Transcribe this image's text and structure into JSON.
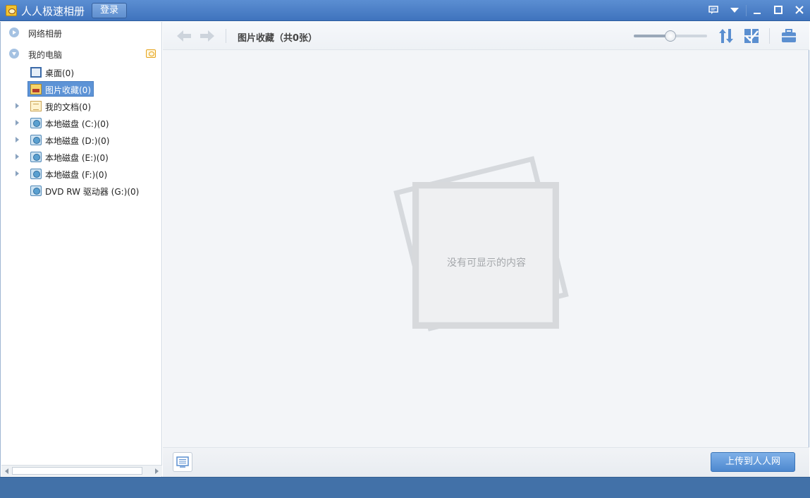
{
  "titlebar": {
    "app_title": "人人极速相册",
    "login_label": "登录",
    "icons": [
      "message-icon",
      "dropdown-icon",
      "minimize-icon",
      "maximize-icon",
      "close-icon"
    ]
  },
  "sidebar": {
    "groups": [
      {
        "label": "网络相册",
        "expanded": false
      },
      {
        "label": "我的电脑",
        "expanded": true
      }
    ],
    "items": [
      {
        "label": "桌面(0)",
        "icon": "desktop-icon",
        "has_arrow": false,
        "selected": false
      },
      {
        "label": "图片收藏(0)",
        "icon": "pictures-folder-icon",
        "has_arrow": false,
        "selected": true
      },
      {
        "label": "我的文档(0)",
        "icon": "documents-icon",
        "has_arrow": true,
        "selected": false
      },
      {
        "label": "本地磁盘 (C:)(0)",
        "icon": "disk-icon",
        "has_arrow": true,
        "selected": false
      },
      {
        "label": "本地磁盘 (D:)(0)",
        "icon": "disk-icon",
        "has_arrow": true,
        "selected": false
      },
      {
        "label": "本地磁盘 (E:)(0)",
        "icon": "disk-icon",
        "has_arrow": true,
        "selected": false
      },
      {
        "label": "本地磁盘 (F:)(0)",
        "icon": "disk-icon",
        "has_arrow": true,
        "selected": false
      },
      {
        "label": "DVD RW 驱动器 (G:)(0)",
        "icon": "dvd-drive-icon",
        "has_arrow": false,
        "selected": false
      }
    ]
  },
  "toolbar": {
    "heading": "图片收藏（共0张）",
    "zoom_level": 0.5
  },
  "main": {
    "empty_message": "没有可显示的内容"
  },
  "bottom": {
    "upload_label": "上传到人人网"
  },
  "colors": {
    "titlebar": "#4a7fc7",
    "selection": "#5d93d6",
    "statusbar": "#4271a8"
  }
}
